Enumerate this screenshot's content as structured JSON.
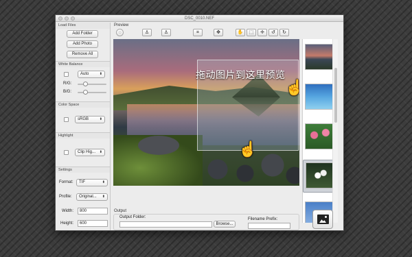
{
  "window": {
    "title": "DSC_0010.NEF"
  },
  "sidebar": {
    "load_files": {
      "title": "Load Files",
      "add_folder": "Add Folder",
      "add_photo": "Add Photo",
      "remove_all": "Remove All"
    },
    "white_balance": {
      "title": "White Balance",
      "mode": "Auto",
      "rg_label": "R/G:",
      "bg_label": "B/G:",
      "rg_level": 0.25,
      "bg_level": 0.25
    },
    "color_space": {
      "title": "Color Space",
      "value": "sRGB"
    },
    "highlight": {
      "title": "Highlight",
      "value": "Clip Hig..."
    },
    "settings": {
      "title": "Settings",
      "format_label": "Format:",
      "format_value": "TIF",
      "profile_label": "Profile:",
      "profile_value": "Original...",
      "width_label": "Width:",
      "width_value": "800",
      "height_label": "Height:",
      "height_value": "600"
    }
  },
  "preview": {
    "title": "Preview",
    "hint": "拖动图片到这里预览",
    "toolbar": [
      "spinner-icon",
      "person-left-icon",
      "person-right-icon",
      "fit-icon",
      "fullscreen-icon",
      "hand-tool-icon",
      "crop-icon",
      "crosshair-icon",
      "rotate-left-icon",
      "rotate-right-icon"
    ]
  },
  "output": {
    "title": "Output",
    "folder_label": "Output Folder:",
    "folder_value": "",
    "browse": "Browse...",
    "prefix_label": "Filename Prefix:",
    "prefix_value": ""
  },
  "colors": {
    "window_bg": "#ececec",
    "selected_thumb": "#cfd3d9"
  }
}
